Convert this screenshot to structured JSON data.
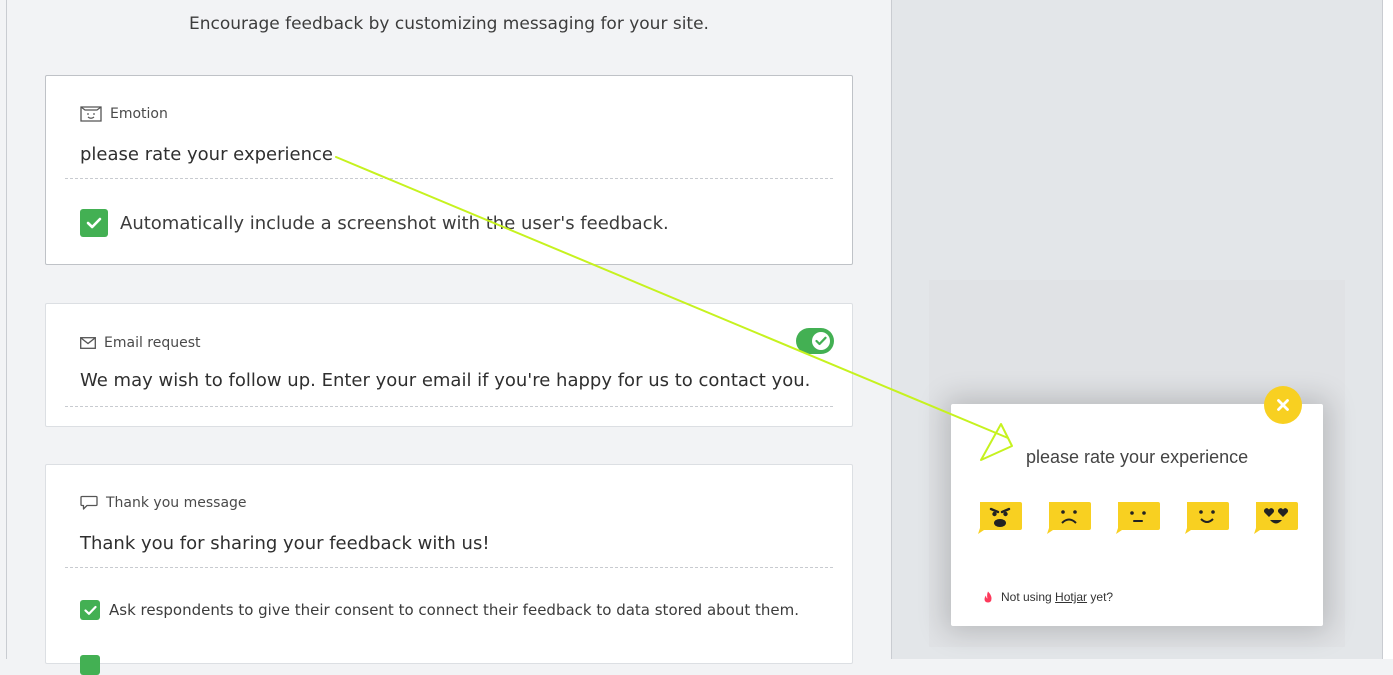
{
  "intro": "Encourage feedback by customizing messaging for your site.",
  "cards": {
    "emotion": {
      "label": "Emotion",
      "text": "please rate your experience",
      "checkbox_label": "Automatically include a screenshot with the user's feedback.",
      "checked": true
    },
    "email": {
      "label": "Email request",
      "text": "We may wish to follow up. Enter your email if you're happy for us to contact you.",
      "toggle_on": true
    },
    "thank_you": {
      "label": "Thank you message",
      "text": "Thank you for sharing your feedback with us!",
      "consent_label": "Ask respondents to give their consent to connect their feedback to data stored about them.",
      "consent_checked": true
    }
  },
  "widget": {
    "question": "please rate your experience",
    "emotions": [
      "angry-face-icon",
      "sad-face-icon",
      "neutral-face-icon",
      "happy-face-icon",
      "love-face-icon"
    ],
    "footer_prefix": "Not using",
    "footer_brand": "Hotjar",
    "footer_suffix": "yet?"
  },
  "colors": {
    "accent_green": "#43b053",
    "widget_yellow": "#f8d021",
    "annotation_line": "#c6f21f",
    "hotjar_red": "#fd3a5c"
  }
}
